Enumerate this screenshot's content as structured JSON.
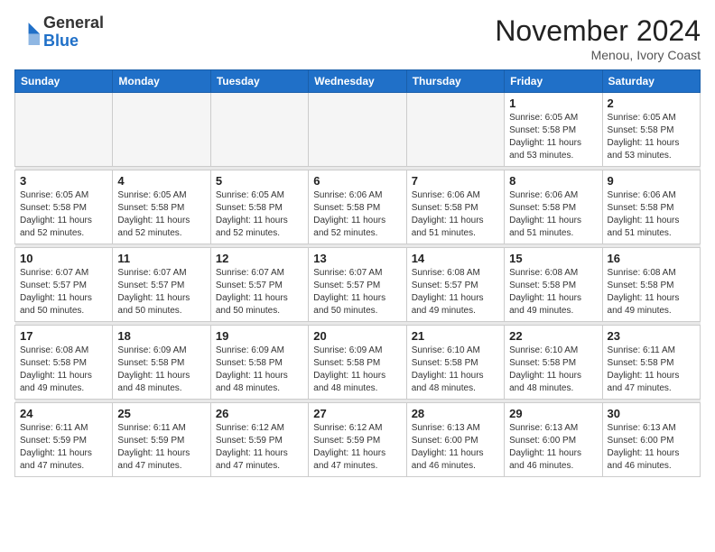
{
  "header": {
    "logo_line1": "General",
    "logo_line2": "Blue",
    "month_title": "November 2024",
    "location": "Menou, Ivory Coast"
  },
  "weekdays": [
    "Sunday",
    "Monday",
    "Tuesday",
    "Wednesday",
    "Thursday",
    "Friday",
    "Saturday"
  ],
  "weeks": [
    [
      {
        "day": "",
        "info": ""
      },
      {
        "day": "",
        "info": ""
      },
      {
        "day": "",
        "info": ""
      },
      {
        "day": "",
        "info": ""
      },
      {
        "day": "",
        "info": ""
      },
      {
        "day": "1",
        "info": "Sunrise: 6:05 AM\nSunset: 5:58 PM\nDaylight: 11 hours\nand 53 minutes."
      },
      {
        "day": "2",
        "info": "Sunrise: 6:05 AM\nSunset: 5:58 PM\nDaylight: 11 hours\nand 53 minutes."
      }
    ],
    [
      {
        "day": "3",
        "info": "Sunrise: 6:05 AM\nSunset: 5:58 PM\nDaylight: 11 hours\nand 52 minutes."
      },
      {
        "day": "4",
        "info": "Sunrise: 6:05 AM\nSunset: 5:58 PM\nDaylight: 11 hours\nand 52 minutes."
      },
      {
        "day": "5",
        "info": "Sunrise: 6:05 AM\nSunset: 5:58 PM\nDaylight: 11 hours\nand 52 minutes."
      },
      {
        "day": "6",
        "info": "Sunrise: 6:06 AM\nSunset: 5:58 PM\nDaylight: 11 hours\nand 52 minutes."
      },
      {
        "day": "7",
        "info": "Sunrise: 6:06 AM\nSunset: 5:58 PM\nDaylight: 11 hours\nand 51 minutes."
      },
      {
        "day": "8",
        "info": "Sunrise: 6:06 AM\nSunset: 5:58 PM\nDaylight: 11 hours\nand 51 minutes."
      },
      {
        "day": "9",
        "info": "Sunrise: 6:06 AM\nSunset: 5:58 PM\nDaylight: 11 hours\nand 51 minutes."
      }
    ],
    [
      {
        "day": "10",
        "info": "Sunrise: 6:07 AM\nSunset: 5:57 PM\nDaylight: 11 hours\nand 50 minutes."
      },
      {
        "day": "11",
        "info": "Sunrise: 6:07 AM\nSunset: 5:57 PM\nDaylight: 11 hours\nand 50 minutes."
      },
      {
        "day": "12",
        "info": "Sunrise: 6:07 AM\nSunset: 5:57 PM\nDaylight: 11 hours\nand 50 minutes."
      },
      {
        "day": "13",
        "info": "Sunrise: 6:07 AM\nSunset: 5:57 PM\nDaylight: 11 hours\nand 50 minutes."
      },
      {
        "day": "14",
        "info": "Sunrise: 6:08 AM\nSunset: 5:57 PM\nDaylight: 11 hours\nand 49 minutes."
      },
      {
        "day": "15",
        "info": "Sunrise: 6:08 AM\nSunset: 5:58 PM\nDaylight: 11 hours\nand 49 minutes."
      },
      {
        "day": "16",
        "info": "Sunrise: 6:08 AM\nSunset: 5:58 PM\nDaylight: 11 hours\nand 49 minutes."
      }
    ],
    [
      {
        "day": "17",
        "info": "Sunrise: 6:08 AM\nSunset: 5:58 PM\nDaylight: 11 hours\nand 49 minutes."
      },
      {
        "day": "18",
        "info": "Sunrise: 6:09 AM\nSunset: 5:58 PM\nDaylight: 11 hours\nand 48 minutes."
      },
      {
        "day": "19",
        "info": "Sunrise: 6:09 AM\nSunset: 5:58 PM\nDaylight: 11 hours\nand 48 minutes."
      },
      {
        "day": "20",
        "info": "Sunrise: 6:09 AM\nSunset: 5:58 PM\nDaylight: 11 hours\nand 48 minutes."
      },
      {
        "day": "21",
        "info": "Sunrise: 6:10 AM\nSunset: 5:58 PM\nDaylight: 11 hours\nand 48 minutes."
      },
      {
        "day": "22",
        "info": "Sunrise: 6:10 AM\nSunset: 5:58 PM\nDaylight: 11 hours\nand 48 minutes."
      },
      {
        "day": "23",
        "info": "Sunrise: 6:11 AM\nSunset: 5:58 PM\nDaylight: 11 hours\nand 47 minutes."
      }
    ],
    [
      {
        "day": "24",
        "info": "Sunrise: 6:11 AM\nSunset: 5:59 PM\nDaylight: 11 hours\nand 47 minutes."
      },
      {
        "day": "25",
        "info": "Sunrise: 6:11 AM\nSunset: 5:59 PM\nDaylight: 11 hours\nand 47 minutes."
      },
      {
        "day": "26",
        "info": "Sunrise: 6:12 AM\nSunset: 5:59 PM\nDaylight: 11 hours\nand 47 minutes."
      },
      {
        "day": "27",
        "info": "Sunrise: 6:12 AM\nSunset: 5:59 PM\nDaylight: 11 hours\nand 47 minutes."
      },
      {
        "day": "28",
        "info": "Sunrise: 6:13 AM\nSunset: 6:00 PM\nDaylight: 11 hours\nand 46 minutes."
      },
      {
        "day": "29",
        "info": "Sunrise: 6:13 AM\nSunset: 6:00 PM\nDaylight: 11 hours\nand 46 minutes."
      },
      {
        "day": "30",
        "info": "Sunrise: 6:13 AM\nSunset: 6:00 PM\nDaylight: 11 hours\nand 46 minutes."
      }
    ]
  ]
}
